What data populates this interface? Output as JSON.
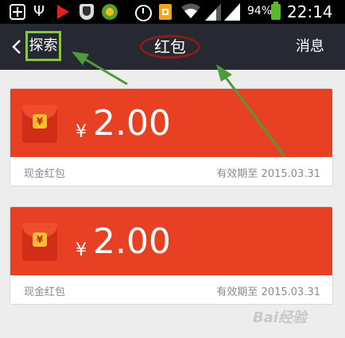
{
  "status_bar": {
    "battery_percent": "94%",
    "time": "22:14"
  },
  "nav": {
    "back_label": "探索",
    "title": "红包",
    "right_button": "消息"
  },
  "cards": [
    {
      "currency": "¥",
      "amount": "2.00",
      "label": "现金红包",
      "expiry": "有效期至 2015.03.31"
    },
    {
      "currency": "¥",
      "amount": "2.00",
      "label": "现金红包",
      "expiry": "有效期至 2015.03.31"
    }
  ],
  "colors": {
    "titlebar": "#262832",
    "card_red": "#e84023",
    "highlight_box": "#8bc34a",
    "oval": "#8b1c1c",
    "arrow": "#4f9a3a"
  },
  "watermark": "Bai经验"
}
